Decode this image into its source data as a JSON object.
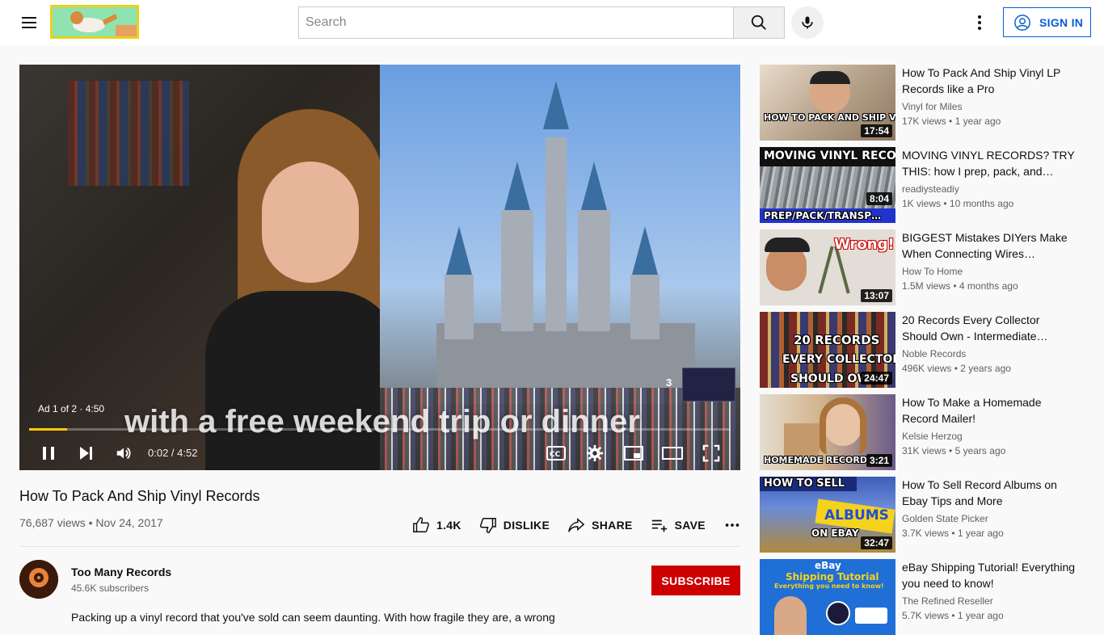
{
  "header": {
    "search_placeholder": "Search",
    "sign_in_label": "SIGN IN"
  },
  "player": {
    "ad_label": "Ad 1 of 2 · 4:50",
    "subtitle": "with a free weekend trip or dinner",
    "skip_count": "3",
    "time": "0:02 / 4:52",
    "progress_fraction": 0.054
  },
  "video": {
    "title": "How To Pack And Ship Vinyl Records",
    "views": "76,687 views",
    "date": "Nov 24, 2017",
    "like_count": "1.4K",
    "dislike_label": "DISLIKE",
    "share_label": "SHARE",
    "save_label": "SAVE"
  },
  "channel": {
    "name": "Too Many Records",
    "subscribers": "45.6K subscribers",
    "subscribe_label": "SUBSCRIBE",
    "description": "Packing up a vinyl record that you've sold can seem daunting. With how fragile they are, a wrong"
  },
  "recommendations": [
    {
      "title": "How To Pack And Ship Vinyl LP Records like a Pro",
      "channel": "Vinyl for Miles",
      "views": "17K views",
      "age": "1 year ago",
      "duration": "17:54",
      "thumb_text": "HOW TO PACK AND SHIP VINYL RECORDS LIKE A",
      "thumb_color": "#c9b9a6"
    },
    {
      "title": "MOVING VINYL RECORDS? TRY THIS: how I prep, pack, and…",
      "channel": "readiysteadiy",
      "views": "1K views",
      "age": "10 months ago",
      "duration": "8:04",
      "thumb_text": "MOVING VINYL RECORDS",
      "thumb_text2": "PREP/PACK/TRANSP…",
      "thumb_color": "#8a8f92"
    },
    {
      "title": "BIGGEST Mistakes DIYers Make When Connecting Wires…",
      "channel": "How To Home",
      "views": "1.5M views",
      "age": "4 months ago",
      "duration": "13:07",
      "thumb_text": "Wrong!",
      "thumb_color": "#d9d4cc"
    },
    {
      "title": "20 Records Every Collector Should Own - Intermediate…",
      "channel": "Noble Records",
      "views": "496K views",
      "age": "2 years ago",
      "duration": "24:47",
      "thumb_text": "20 RECORDS",
      "thumb_text2": "EVERY COLLECTOR",
      "thumb_text3": "SHOULD OWN.",
      "thumb_color": "#6b4a32"
    },
    {
      "title": "How To Make a Homemade Record Mailer!",
      "channel": "Kelsie Herzog",
      "views": "31K views",
      "age": "5 years ago",
      "duration": "3:21",
      "thumb_text": "HOMEMADE RECORD MA",
      "thumb_color": "#d2b48c"
    },
    {
      "title": "How To Sell Record Albums on Ebay Tips and More",
      "channel": "Golden State Picker",
      "views": "3.7K views",
      "age": "1 year ago",
      "duration": "32:47",
      "thumb_text": "HOW TO SELL",
      "thumb_text2": "ALBUMS",
      "thumb_text3": "ON EBAY",
      "thumb_color": "#3d5db8"
    },
    {
      "title": "eBay Shipping Tutorial! Everything you need to know!",
      "channel": "The Refined Reseller",
      "views": "5.7K views",
      "age": "1 year ago",
      "duration": "",
      "thumb_text": "eBay",
      "thumb_text2": "Shipping Tutorial",
      "thumb_text3": "Everything you need to know!",
      "thumb_color": "#1f6fd6"
    }
  ],
  "colors": {
    "brand_red": "#cc0000",
    "link_blue": "#065fd4",
    "ad_progress": "#ffcc00"
  }
}
